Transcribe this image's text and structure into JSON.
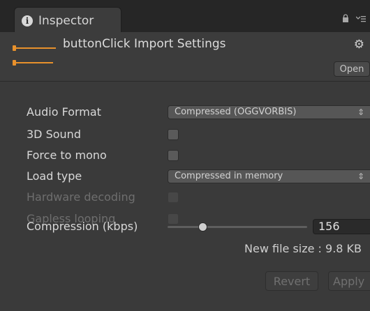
{
  "tab": {
    "label": "Inspector",
    "icon": "info-icon"
  },
  "tab_controls": {
    "lock": "lock-icon",
    "menu": "menu-icon"
  },
  "header": {
    "title": "buttonClick Import Settings",
    "gear": "gear-icon",
    "open_label": "Open",
    "accent": "#e8912c"
  },
  "properties": {
    "audio_format": {
      "label": "Audio Format",
      "value": "Compressed (OGGVORBIS)"
    },
    "sound_3d": {
      "label": "3D Sound",
      "checked": false
    },
    "force_mono": {
      "label": "Force to mono",
      "checked": false
    },
    "load_type": {
      "label": "Load type",
      "value": "Compressed in memory"
    },
    "hardware_decoding": {
      "label": "Hardware decoding",
      "checked": false,
      "enabled": false
    },
    "gapless_looping": {
      "label": "Gapless looping",
      "checked": false,
      "enabled": false
    },
    "compression": {
      "label": "Compression (kbps)",
      "value": "156",
      "slider_fraction": 0.25
    }
  },
  "file_size": "New file size : 9.8 KB",
  "buttons": {
    "revert": "Revert",
    "apply": "Apply"
  }
}
